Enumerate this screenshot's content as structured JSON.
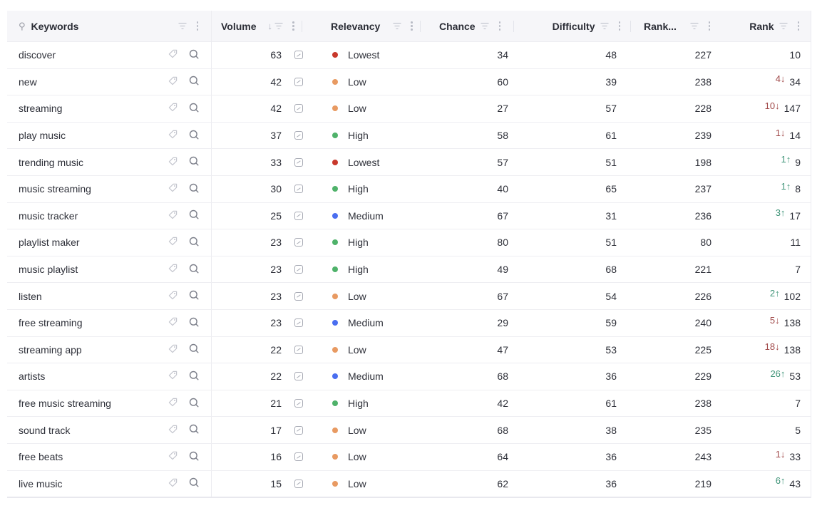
{
  "columns": [
    {
      "key": "keyword",
      "label": "Keywords",
      "pinned": true
    },
    {
      "key": "volume",
      "label": "Volume",
      "sorted": "descending"
    },
    {
      "key": "relevancy",
      "label": "Relevancy"
    },
    {
      "key": "chance",
      "label": "Chance"
    },
    {
      "key": "difficulty",
      "label": "Difficulty"
    },
    {
      "key": "rank_truncated",
      "label": "Rank..."
    },
    {
      "key": "rank",
      "label": "Rank"
    }
  ],
  "header_icons": {
    "pin": "pin-icon",
    "filter": "filter-icon",
    "menu": "kebab-menu-icon",
    "sort": "sort-descending-arrow-icon"
  },
  "row_icons": {
    "tag": "tag-icon",
    "search": "search-icon",
    "trend": "trend-chart-icon"
  },
  "relevancy_colors": {
    "Lowest": "#c8382b",
    "Low": "#e89a62",
    "Medium": "#4a6ef0",
    "High": "#4fb26a"
  },
  "rank_change_colors": {
    "down": "#a14a4a",
    "up": "#3f9478"
  },
  "rows": [
    {
      "keyword": "discover",
      "volume": "63",
      "relevancy": "Lowest",
      "chance": "34",
      "difficulty": "48",
      "rank_truncated": "227",
      "rank_change": "",
      "rank_dir": "",
      "rank": "10"
    },
    {
      "keyword": "new",
      "volume": "42",
      "relevancy": "Low",
      "chance": "60",
      "difficulty": "39",
      "rank_truncated": "238",
      "rank_change": "4↓",
      "rank_dir": "down",
      "rank": "34"
    },
    {
      "keyword": "streaming",
      "volume": "42",
      "relevancy": "Low",
      "chance": "27",
      "difficulty": "57",
      "rank_truncated": "228",
      "rank_change": "10↓",
      "rank_dir": "down",
      "rank": "147"
    },
    {
      "keyword": "play music",
      "volume": "37",
      "relevancy": "High",
      "chance": "58",
      "difficulty": "61",
      "rank_truncated": "239",
      "rank_change": "1↓",
      "rank_dir": "down",
      "rank": "14"
    },
    {
      "keyword": "trending music",
      "volume": "33",
      "relevancy": "Lowest",
      "chance": "57",
      "difficulty": "51",
      "rank_truncated": "198",
      "rank_change": "1↑",
      "rank_dir": "up",
      "rank": "9"
    },
    {
      "keyword": "music streaming",
      "volume": "30",
      "relevancy": "High",
      "chance": "40",
      "difficulty": "65",
      "rank_truncated": "237",
      "rank_change": "1↑",
      "rank_dir": "up",
      "rank": "8"
    },
    {
      "keyword": "music tracker",
      "volume": "25",
      "relevancy": "Medium",
      "chance": "67",
      "difficulty": "31",
      "rank_truncated": "236",
      "rank_change": "3↑",
      "rank_dir": "up",
      "rank": "17"
    },
    {
      "keyword": "playlist maker",
      "volume": "23",
      "relevancy": "High",
      "chance": "80",
      "difficulty": "51",
      "rank_truncated": "80",
      "rank_change": "",
      "rank_dir": "",
      "rank": "11"
    },
    {
      "keyword": "music playlist",
      "volume": "23",
      "relevancy": "High",
      "chance": "49",
      "difficulty": "68",
      "rank_truncated": "221",
      "rank_change": "",
      "rank_dir": "",
      "rank": "7"
    },
    {
      "keyword": "listen",
      "volume": "23",
      "relevancy": "Low",
      "chance": "67",
      "difficulty": "54",
      "rank_truncated": "226",
      "rank_change": "2↑",
      "rank_dir": "up",
      "rank": "102"
    },
    {
      "keyword": "free streaming",
      "volume": "23",
      "relevancy": "Medium",
      "chance": "29",
      "difficulty": "59",
      "rank_truncated": "240",
      "rank_change": "5↓",
      "rank_dir": "down",
      "rank": "138"
    },
    {
      "keyword": "streaming app",
      "volume": "22",
      "relevancy": "Low",
      "chance": "47",
      "difficulty": "53",
      "rank_truncated": "225",
      "rank_change": "18↓",
      "rank_dir": "down",
      "rank": "138"
    },
    {
      "keyword": "artists",
      "volume": "22",
      "relevancy": "Medium",
      "chance": "68",
      "difficulty": "36",
      "rank_truncated": "229",
      "rank_change": "26↑",
      "rank_dir": "up",
      "rank": "53"
    },
    {
      "keyword": "free music streaming",
      "volume": "21",
      "relevancy": "High",
      "chance": "42",
      "difficulty": "61",
      "rank_truncated": "238",
      "rank_change": "",
      "rank_dir": "",
      "rank": "7"
    },
    {
      "keyword": "sound track",
      "volume": "17",
      "relevancy": "Low",
      "chance": "68",
      "difficulty": "38",
      "rank_truncated": "235",
      "rank_change": "",
      "rank_dir": "",
      "rank": "5"
    },
    {
      "keyword": "free beats",
      "volume": "16",
      "relevancy": "Low",
      "chance": "64",
      "difficulty": "36",
      "rank_truncated": "243",
      "rank_change": "1↓",
      "rank_dir": "down",
      "rank": "33"
    },
    {
      "keyword": "live music",
      "volume": "15",
      "relevancy": "Low",
      "chance": "62",
      "difficulty": "36",
      "rank_truncated": "219",
      "rank_change": "6↑",
      "rank_dir": "up",
      "rank": "43"
    }
  ]
}
